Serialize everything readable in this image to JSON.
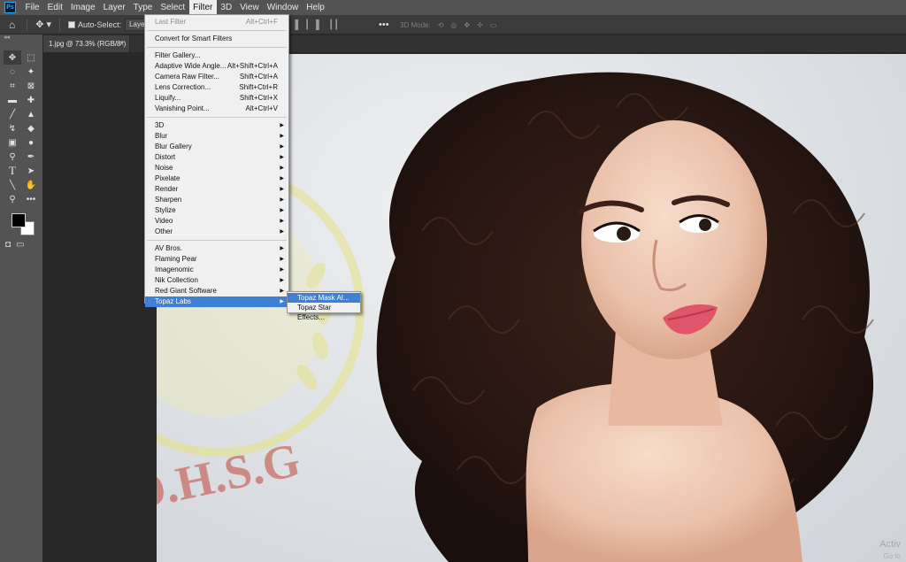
{
  "menubar": {
    "logo": "Ps",
    "items": [
      "File",
      "Edit",
      "Image",
      "Layer",
      "Type",
      "Select",
      "Filter",
      "3D",
      "View",
      "Window",
      "Help"
    ],
    "active": "Filter"
  },
  "options": {
    "auto_select_label": "Auto-Select:",
    "auto_select_value": "Layer",
    "more": "•••",
    "mode_3d": "3D Mode:"
  },
  "document": {
    "tab_title": "1.jpg @ 73.3% (RGB/8*)",
    "close": "×"
  },
  "filter_menu": {
    "items": [
      {
        "label": "Last Filter",
        "shortcut": "Alt+Ctrl+F",
        "disabled": true
      },
      {
        "sep": true
      },
      {
        "label": "Convert for Smart Filters"
      },
      {
        "sep": true
      },
      {
        "label": "Filter Gallery..."
      },
      {
        "label": "Adaptive Wide Angle...",
        "shortcut": "Alt+Shift+Ctrl+A"
      },
      {
        "label": "Camera Raw Filter...",
        "shortcut": "Shift+Ctrl+A"
      },
      {
        "label": "Lens Correction...",
        "shortcut": "Shift+Ctrl+R"
      },
      {
        "label": "Liquify...",
        "shortcut": "Shift+Ctrl+X"
      },
      {
        "label": "Vanishing Point...",
        "shortcut": "Alt+Ctrl+V"
      },
      {
        "sep": true
      },
      {
        "label": "3D",
        "submenu": true
      },
      {
        "label": "Blur",
        "submenu": true
      },
      {
        "label": "Blur Gallery",
        "submenu": true
      },
      {
        "label": "Distort",
        "submenu": true
      },
      {
        "label": "Noise",
        "submenu": true
      },
      {
        "label": "Pixelate",
        "submenu": true
      },
      {
        "label": "Render",
        "submenu": true
      },
      {
        "label": "Sharpen",
        "submenu": true
      },
      {
        "label": "Stylize",
        "submenu": true
      },
      {
        "label": "Video",
        "submenu": true
      },
      {
        "label": "Other",
        "submenu": true
      },
      {
        "sep": true
      },
      {
        "label": "AV Bros.",
        "submenu": true
      },
      {
        "label": "Flaming Pear",
        "submenu": true
      },
      {
        "label": "Imagenomic",
        "submenu": true
      },
      {
        "label": "Nik Collection",
        "submenu": true
      },
      {
        "label": "Red Giant Software",
        "submenu": true
      },
      {
        "label": "Topaz Labs",
        "submenu": true,
        "highlighted": true
      }
    ],
    "submenu_topaz": [
      "Topaz Mask AI...",
      "Topaz Star Effects..."
    ],
    "submenu_highlight_index": 0
  },
  "watermark": {
    "text": "D.H.S.G",
    "color": "#c0392b",
    "wreath_color": "#e6e27a"
  },
  "windows_activation": {
    "line1": "Activ",
    "line2": "Go to"
  },
  "colors": {
    "menu_highlight": "#3f7fd4",
    "foreground": "#000000",
    "background": "#ffffff",
    "ps_blue": "#31a8ff"
  },
  "tool_icons": [
    "move-tool",
    "artboard-tool",
    "lasso-tool",
    "magic-wand-tool",
    "crop-tool",
    "frame-tool",
    "eyedropper-tool",
    "healing-tool",
    "brush-tool",
    "stamp-tool",
    "history-brush-tool",
    "eraser-tool",
    "gradient-tool",
    "blur-tool",
    "dodge-tool",
    "pen-tool",
    "type-tool",
    "path-select-tool",
    "line-tool",
    "hand-tool",
    "zoom-tool",
    "more-tools"
  ]
}
